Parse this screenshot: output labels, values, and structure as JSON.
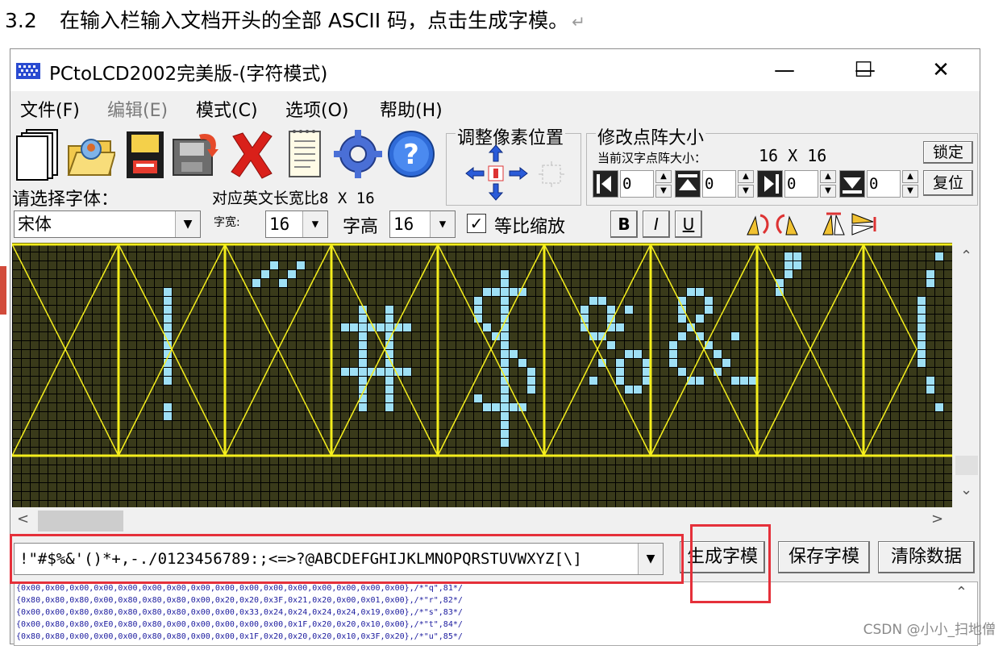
{
  "doc": {
    "section_number": "3.2",
    "instruction": "在输入栏输入文档开头的全部 ASCII 码，点击生成字模。",
    "return_mark": "↵"
  },
  "window": {
    "title": "PCtoLCD2002完美版-(字符模式)",
    "minimize": "—",
    "maximize": "☐",
    "close": "✕"
  },
  "menu": [
    "文件(F)",
    "编辑(E)",
    "模式(C)",
    "选项(O)",
    "帮助(H)"
  ],
  "toolbar": {
    "icons": [
      "new-file-icon",
      "open-folder-icon",
      "save-disk-icon",
      "save-as-icon",
      "delete-x-icon",
      "notepad-icon",
      "settings-gear-icon",
      "help-question-icon"
    ],
    "help_glyph": "?"
  },
  "pixel_adjust": {
    "title": "调整像素位置"
  },
  "matrix_size": {
    "title": "修改点阵大小",
    "current_label": "当前汉字点阵大小：",
    "current_value": "16 X 16",
    "lock_button": "锁定",
    "reset_button": "复位",
    "spinners": [
      {
        "icon": "expand-left-icon",
        "value": "0"
      },
      {
        "icon": "expand-top-icon",
        "value": "0"
      },
      {
        "icon": "expand-right-icon",
        "value": "0"
      },
      {
        "icon": "expand-bottom-icon",
        "value": "0"
      }
    ]
  },
  "font": {
    "select_label": "请选择字体：",
    "english_ratio_label": "对应英文长宽比",
    "english_ratio_value": "8 X 16",
    "font_name": "宋体",
    "width_label": "字宽:",
    "width_value": "16",
    "height_label": "字高",
    "height_value": "16",
    "proportional_label": "等比缩放",
    "proportional_checked": true
  },
  "style_buttons": [
    "B",
    "I",
    "U"
  ],
  "input": {
    "text": "!\"#$%&'()*+,-./0123456789:;<=>?@ABCDEFGHIJKLMNOPQRSTUVWXYZ[\\]"
  },
  "buttons": {
    "generate": "生成字模",
    "save": "保存字模",
    "clear": "清除数据"
  },
  "output_lines": [
    "{0x00,0x00,0x00,0x00,0x00,0x00,0x00,0x00,0x00,0x00,0x00,0x00,0x00,0x00,0x00,0x00},/*\"q\",81*/",
    "{0x80,0x80,0x80,0x00,0x80,0x80,0x80,0x00,0x20,0x20,0x3F,0x21,0x20,0x00,0x01,0x00},/*\"r\",82*/",
    "{0x00,0x00,0x80,0x80,0x80,0x80,0x80,0x00,0x00,0x33,0x24,0x24,0x24,0x24,0x19,0x00},/*\"s\",83*/",
    "{0x00,0x80,0x80,0xE0,0x80,0x80,0x00,0x00,0x00,0x00,0x00,0x1F,0x20,0x20,0x10,0x00},/*\"t\",84*/",
    "{0x80,0x80,0x00,0x00,0x00,0x80,0x80,0x00,0x00,0x1F,0x20,0x20,0x20,0x10,0x3F,0x20},/*\"u\",85*/"
  ],
  "watermark": "CSDN @小小_扫地僧"
}
